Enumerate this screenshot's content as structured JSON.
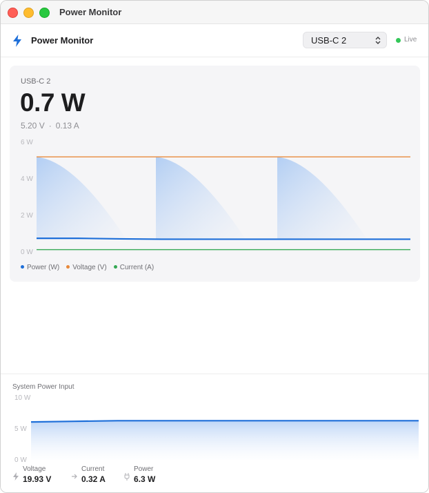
{
  "window": {
    "title": "Power Monitor"
  },
  "header": {
    "app_title": "Power Monitor",
    "device_select": {
      "selected": "USB-C 2"
    },
    "status": "Live"
  },
  "main": {
    "device_name": "USB-C 2",
    "power": "0.7 W",
    "voltage": "5.20 V",
    "current": "0.13 A",
    "separator": "·"
  },
  "bottom": {
    "title": "System Power Input",
    "stats": [
      {
        "label": "Voltage",
        "value": "19.93 V"
      },
      {
        "label": "Current",
        "value": "0.32 A"
      },
      {
        "label": "Power",
        "value": "6.3 W"
      }
    ]
  },
  "colors": {
    "power": "#1e6fd9",
    "voltage": "#e8893a",
    "current": "#34a853",
    "accent": "#1e6fd9",
    "live": "#34c759"
  },
  "chart_data": [
    {
      "type": "line",
      "yticks": [
        "6 W",
        "4 W",
        "2 W",
        "0 W"
      ],
      "ylim": [
        0,
        6
      ],
      "grid": false,
      "legend_position": "bottom-left",
      "series": [
        {
          "name": "Power (W)",
          "color": "#1e6fd9",
          "values": [
            0.75,
            0.75,
            0.72,
            0.7,
            0.7,
            0.7,
            0.7,
            0.7,
            0.7,
            0.7
          ]
        },
        {
          "name": "Voltage (V)",
          "color": "#e8893a",
          "values": [
            5.2,
            5.2,
            5.2,
            5.2,
            5.2,
            5.2,
            5.2,
            5.2,
            5.2,
            5.2
          ]
        },
        {
          "name": "Current (A)",
          "color": "#34a853",
          "values": [
            0.13,
            0.13,
            0.13,
            0.13,
            0.13,
            0.13,
            0.13,
            0.13,
            0.13,
            0.13
          ]
        }
      ]
    },
    {
      "type": "area",
      "yticks": [
        "10 W",
        "5 W",
        "0 W"
      ],
      "ylim": [
        0,
        10
      ],
      "grid": false,
      "series": [
        {
          "name": "",
          "color": "#1e6fd9",
          "values": [
            6.1,
            6.2,
            6.3,
            6.3,
            6.3,
            6.3,
            6.3,
            6.3,
            6.3,
            6.3
          ]
        }
      ]
    }
  ]
}
